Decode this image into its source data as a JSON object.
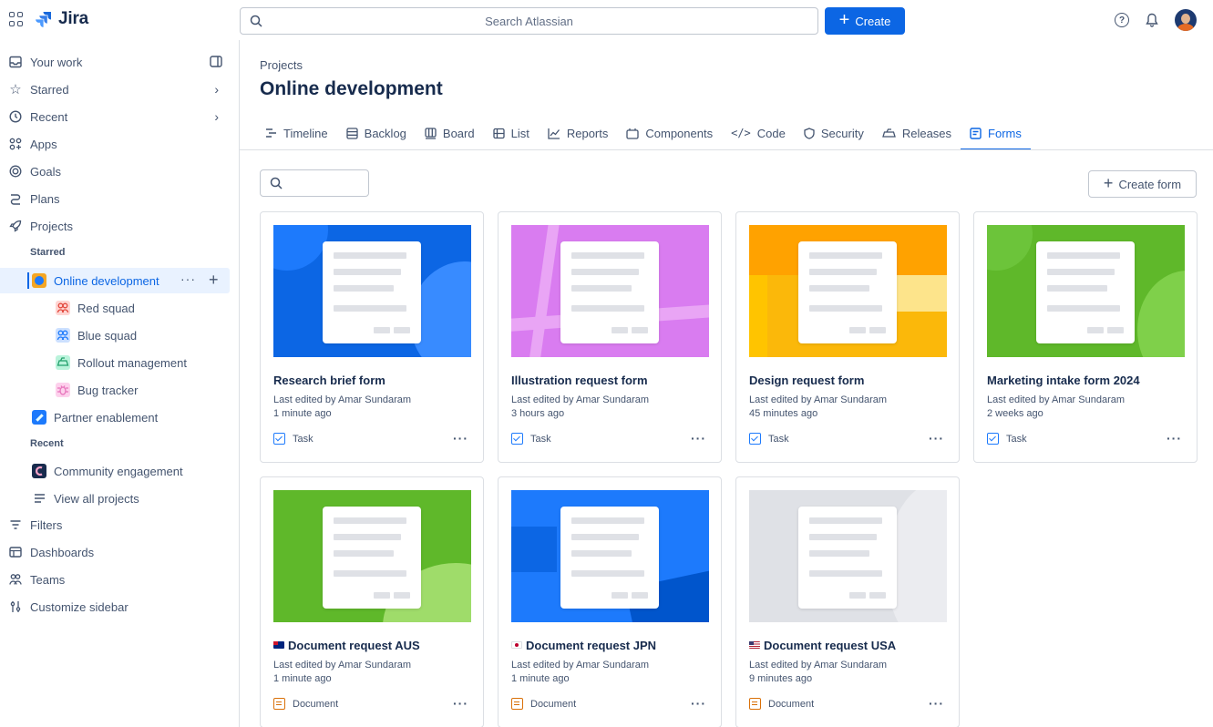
{
  "topbar": {
    "logo_text": "Jira",
    "search_placeholder": "Search Atlassian",
    "create_label": "Create"
  },
  "sidebar": {
    "items_top": [
      {
        "label": "Your work",
        "icon": "inbox-icon"
      },
      {
        "label": "Starred",
        "icon": "star-icon"
      },
      {
        "label": "Recent",
        "icon": "clock-icon"
      },
      {
        "label": "Apps",
        "icon": "apps-icon"
      },
      {
        "label": "Goals",
        "icon": "target-icon"
      },
      {
        "label": "Plans",
        "icon": "plans-icon"
      },
      {
        "label": "Projects",
        "icon": "rocket-icon"
      }
    ],
    "starred_label": "Starred",
    "recent_label": "Recent",
    "starred_projects": [
      {
        "label": "Online development",
        "color": "#f5a623"
      },
      {
        "label": "Red squad",
        "color": "#e2483d"
      },
      {
        "label": "Blue squad",
        "color": "#1d7afc"
      },
      {
        "label": "Rollout management",
        "color": "#22a06b"
      },
      {
        "label": "Bug tracker",
        "color": "#e774bb"
      },
      {
        "label": "Partner enablement",
        "color": "#1d7afc"
      }
    ],
    "recent_projects": [
      {
        "label": "Community engagement",
        "color": "#172b4d"
      }
    ],
    "view_all": "View all projects",
    "items_bottom": [
      {
        "label": "Filters",
        "icon": "filter-icon"
      },
      {
        "label": "Dashboards",
        "icon": "dashboard-icon"
      },
      {
        "label": "Teams",
        "icon": "teams-icon"
      },
      {
        "label": "Customize sidebar",
        "icon": "customize-icon"
      }
    ]
  },
  "main": {
    "breadcrumb": "Projects",
    "title": "Online development",
    "tabs": [
      {
        "label": "Timeline",
        "icon": "timeline-icon"
      },
      {
        "label": "Backlog",
        "icon": "backlog-icon"
      },
      {
        "label": "Board",
        "icon": "board-icon"
      },
      {
        "label": "List",
        "icon": "list-icon"
      },
      {
        "label": "Reports",
        "icon": "reports-icon"
      },
      {
        "label": "Components",
        "icon": "components-icon"
      },
      {
        "label": "Code",
        "icon": "code-icon"
      },
      {
        "label": "Security",
        "icon": "shield-icon"
      },
      {
        "label": "Releases",
        "icon": "ship-icon"
      },
      {
        "label": "Forms",
        "icon": "form-icon"
      }
    ],
    "active_tab": "Forms",
    "create_form_label": "Create form",
    "cards": [
      {
        "title": "Research brief form",
        "editor": "Last edited by Amar Sundaram",
        "time": "1 minute ago",
        "type": "Task",
        "theme": "#0c66e4"
      },
      {
        "title": "Illustration request form",
        "editor": "Last edited by Amar Sundaram",
        "time": "3 hours ago",
        "type": "Task",
        "theme": "#d97cf0"
      },
      {
        "title": "Design request form",
        "editor": "Last edited by Amar Sundaram",
        "time": "45 minutes ago",
        "type": "Task",
        "theme": "#fbb80a"
      },
      {
        "title": "Marketing intake form 2024",
        "editor": "Last edited by Amar Sundaram",
        "time": "2 weeks ago",
        "type": "Task",
        "theme": "#5fb82a"
      },
      {
        "title": "Document request AUS",
        "editor": "Last edited by Amar Sundaram",
        "time": "1 minute ago",
        "type": "Document",
        "theme": "#5fb82a",
        "flag": "au-flag-icon"
      },
      {
        "title": "Document request JPN",
        "editor": "Last edited by Amar Sundaram",
        "time": "1 minute ago",
        "type": "Document",
        "theme": "#1d7afc",
        "flag": "jp-flag-icon"
      },
      {
        "title": "Document request USA",
        "editor": "Last edited by Amar Sundaram",
        "time": "9 minutes ago",
        "type": "Document",
        "theme": "#dcdfe4",
        "flag": "us-flag-icon"
      }
    ]
  }
}
